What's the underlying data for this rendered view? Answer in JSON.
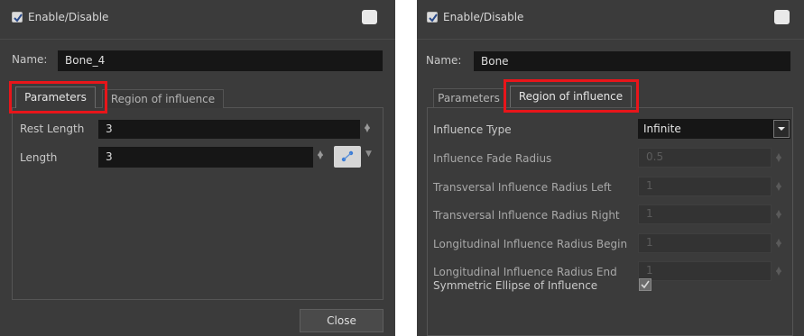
{
  "left": {
    "enable_label": "Enable/Disable",
    "name_label": "Name:",
    "name_value": "Bone_4",
    "tabs": [
      {
        "label": "Parameters",
        "active": true
      },
      {
        "label": "Region of influence",
        "active": false
      }
    ],
    "params": [
      {
        "label": "Rest Length",
        "value": "3"
      },
      {
        "label": "Length",
        "value": "3"
      }
    ],
    "close_label": "Close"
  },
  "right": {
    "enable_label": "Enable/Disable",
    "name_label": "Name:",
    "name_value": "Bone",
    "tabs": [
      {
        "label": "Parameters",
        "active": false
      },
      {
        "label": "Region of influence",
        "active": true
      }
    ],
    "influence_type_label": "Influence Type",
    "influence_type_value": "Infinite",
    "rows": [
      {
        "label": "Influence Fade Radius",
        "value": "0.5"
      },
      {
        "label": "Transversal Influence Radius Left",
        "value": "1"
      },
      {
        "label": "Transversal Influence Radius Right",
        "value": "1"
      },
      {
        "label": "Longitudinal Influence Radius Begin",
        "value": "1"
      },
      {
        "label": "Longitudinal Influence Radius End",
        "value": "1"
      }
    ],
    "symmetric_label": "Symmetric Ellipse of Influence",
    "symmetric_checked": true
  },
  "colors": {
    "highlight": "#e8151a",
    "panel_bg": "#3b3b3b",
    "field_bg": "#161616"
  },
  "icons": {
    "checkbox": "check-icon",
    "spin": "up-down-arrows-icon",
    "bone_tool": "bone-tool-icon",
    "dropdown": "chevron-down-icon"
  }
}
